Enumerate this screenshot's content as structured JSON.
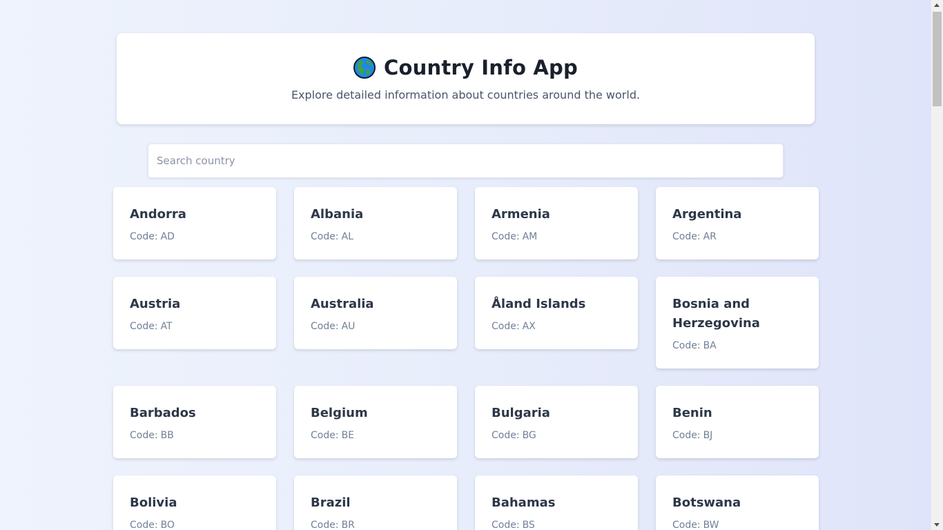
{
  "header": {
    "title": "Country Info App",
    "subtitle": "Explore detailed information about countries around the world.",
    "icon": "globe-americas-icon"
  },
  "search": {
    "placeholder": "Search country",
    "value": ""
  },
  "countries": [
    {
      "name": "Andorra",
      "code": "AD"
    },
    {
      "name": "Albania",
      "code": "AL"
    },
    {
      "name": "Armenia",
      "code": "AM"
    },
    {
      "name": "Argentina",
      "code": "AR"
    },
    {
      "name": "Austria",
      "code": "AT"
    },
    {
      "name": "Australia",
      "code": "AU"
    },
    {
      "name": "Åland Islands",
      "code": "AX"
    },
    {
      "name": "Bosnia and Herzegovina",
      "code": "BA"
    },
    {
      "name": "Barbados",
      "code": "BB"
    },
    {
      "name": "Belgium",
      "code": "BE"
    },
    {
      "name": "Bulgaria",
      "code": "BG"
    },
    {
      "name": "Benin",
      "code": "BJ"
    },
    {
      "name": "Bolivia",
      "code": "BO"
    },
    {
      "name": "Brazil",
      "code": "BR"
    },
    {
      "name": "Bahamas",
      "code": "BS"
    },
    {
      "name": "Botswana",
      "code": "BW"
    }
  ],
  "labels": {
    "code_prefix": "Code:"
  },
  "colors": {
    "card_title": "#2d3748",
    "card_code": "#718096",
    "background": "#e8edfb"
  }
}
